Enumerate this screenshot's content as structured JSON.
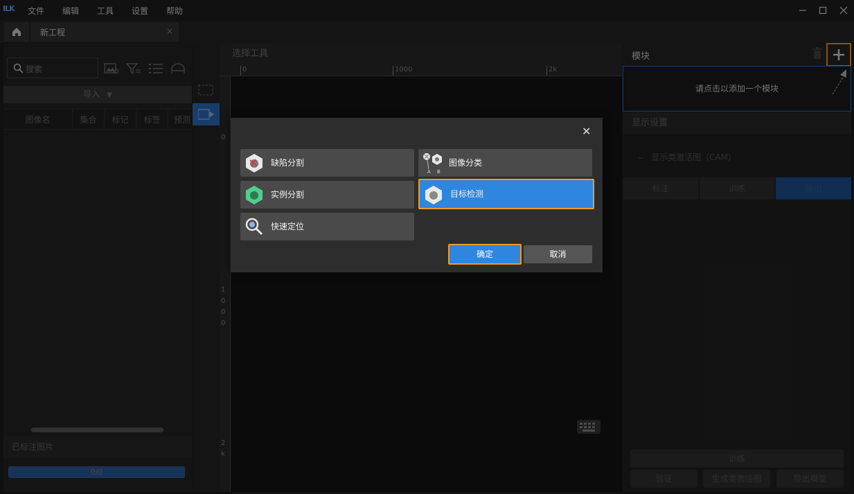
{
  "app": {
    "logo": "ILK",
    "menu": [
      "文件",
      "编辑",
      "工具",
      "设置",
      "帮助"
    ]
  },
  "tabs": {
    "project_tab": "新工程",
    "close_glyph": "×"
  },
  "left_panel": {
    "search_placeholder": "搜索",
    "import_label": "导入",
    "columns": [
      "图像名",
      "集合",
      "标记",
      "标签",
      "预测"
    ],
    "labeled_images_label": "已标注图片",
    "progress": {
      "value": 1.0,
      "text": "0/0"
    }
  },
  "canvas": {
    "header": "选择工具",
    "ruler_top": [
      "0",
      "1000",
      "2k"
    ],
    "ruler_left": [
      "0",
      "1",
      "0",
      "0",
      "0",
      "2",
      "k"
    ]
  },
  "right_panel": {
    "module_label": "模块",
    "add_module_hint": "请点击以添加一个模块",
    "display_settings_label": "显示设置",
    "cam_label": "显示类激活图（CAM）",
    "segments": [
      "标注",
      "训练",
      "输出"
    ],
    "bottom_buttons": {
      "train": "训练",
      "validate": "验证",
      "generate_cam": "生成类激活图",
      "export_model": "导出模型"
    }
  },
  "dialog": {
    "options": [
      {
        "label": "缺陷分割",
        "icon": "defect-segmentation-icon"
      },
      {
        "label": "图像分类",
        "icon": "image-classification-icon"
      },
      {
        "label": "实例分割",
        "icon": "instance-segmentation-icon"
      },
      {
        "label": "目标检测",
        "icon": "object-detection-icon",
        "selected": true
      },
      {
        "label": "快速定位",
        "icon": "fast-positioning-icon"
      }
    ],
    "confirm_label": "确定",
    "cancel_label": "取消",
    "close_glyph": "✕"
  },
  "colors": {
    "accent": "#2e86de",
    "highlight": "#f39a1e"
  }
}
